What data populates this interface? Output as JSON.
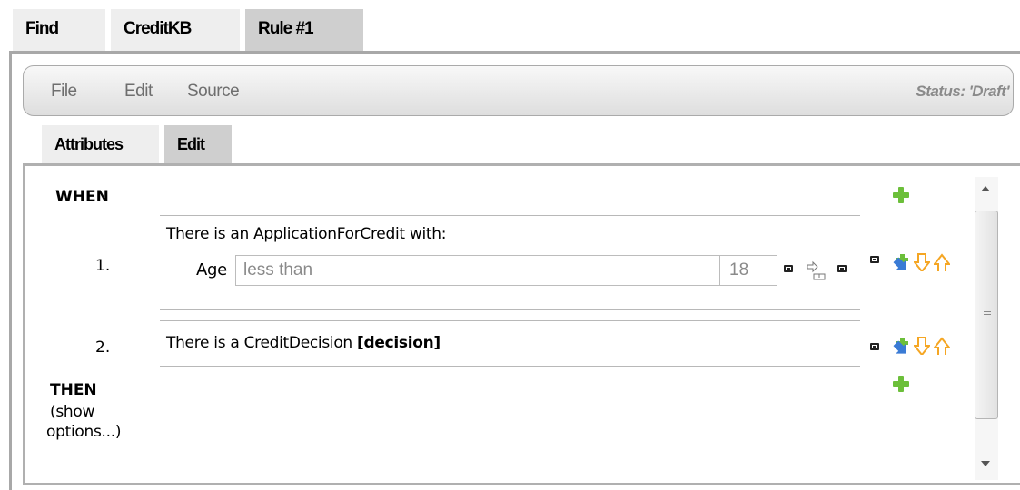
{
  "top_tabs": [
    {
      "label": "Find"
    },
    {
      "label": "CreditKB"
    },
    {
      "label": "Rule #1"
    }
  ],
  "menubar": {
    "items": [
      {
        "label": "File"
      },
      {
        "label": "Edit"
      },
      {
        "label": "Source"
      }
    ],
    "status": "Status: 'Draft'"
  },
  "sub_tabs": [
    {
      "label": "Attributes"
    },
    {
      "label": "Edit"
    }
  ],
  "rule": {
    "when_label": "WHEN",
    "then_label": "THEN",
    "show_options_line1": "(show",
    "show_options_line2": "options...)",
    "conditions": [
      {
        "number": "1.",
        "text": "There is an ApplicationForCredit with:",
        "field_label": "Age",
        "operator": "less than",
        "value": "18"
      },
      {
        "number": "2.",
        "text": "There is a CreditDecision",
        "binding": "[decision]"
      }
    ]
  },
  "icons": {
    "accent_green": "#6cbf3a",
    "accent_orange": "#f5a623",
    "accent_blue": "#3a7bd5"
  }
}
